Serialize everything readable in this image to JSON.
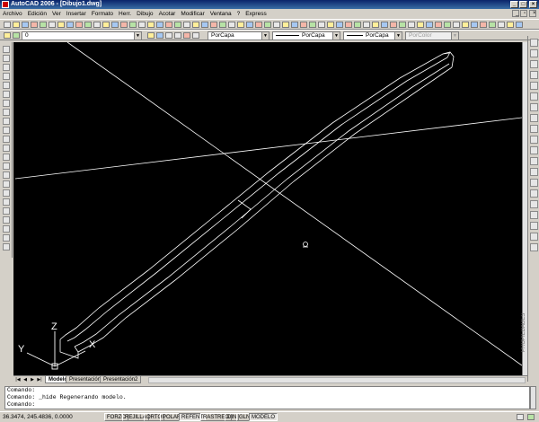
{
  "window": {
    "title": "AutoCAD 2006 - [Dibujo1.dwg]"
  },
  "menu": [
    "Archivo",
    "Edición",
    "Ver",
    "Insertar",
    "Formato",
    "Herr.",
    "Dibujo",
    "Acotar",
    "Modificar",
    "Ventana",
    "?",
    "Express"
  ],
  "layer_toolbar": {
    "layer": "0",
    "color": "PorCapa",
    "linetype": "PorCapa",
    "lineweight": "PorCapa",
    "plotstyle": "PorColor"
  },
  "viewport": {
    "ucs": {
      "z_label": "Z",
      "y_label": "Y",
      "x_label": "X"
    },
    "side_palette_label": "PROPIEDADES"
  },
  "tabs": [
    {
      "label": "Modelo",
      "active": true
    },
    {
      "label": "Presentación1",
      "active": false
    },
    {
      "label": "Presentación2",
      "active": false
    }
  ],
  "command_lines": [
    "Comando:",
    "Comando:  _hide Regenerando modelo.",
    "Comando:"
  ],
  "status": {
    "coordinates": "36.3474, 245.4836, 0.0000",
    "toggles": [
      {
        "label": "FORZC",
        "on": false
      },
      {
        "label": "REJILLA",
        "on": false
      },
      {
        "label": "ORTO",
        "on": false
      },
      {
        "label": "POLAR",
        "on": false
      },
      {
        "label": "REFENT",
        "on": true
      },
      {
        "label": "RASTREO",
        "on": false
      },
      {
        "label": "DIN",
        "on": false
      },
      {
        "label": "GLN",
        "on": false
      },
      {
        "label": "MODELO",
        "on": true
      }
    ]
  },
  "colors": {
    "canvas": "#000000",
    "drawing": "#ffffff",
    "titlebar": "#0a246a"
  }
}
